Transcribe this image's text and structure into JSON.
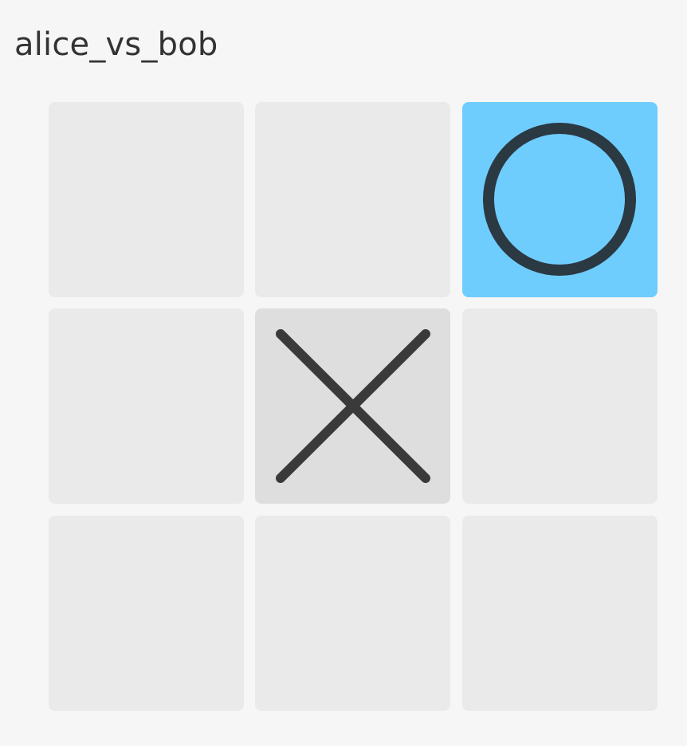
{
  "game": {
    "title": "alice_vs_bob"
  },
  "board": {
    "cells": [
      {
        "mark": "",
        "state": "empty"
      },
      {
        "mark": "",
        "state": "empty"
      },
      {
        "mark": "O",
        "state": "last-move"
      },
      {
        "mark": "",
        "state": "empty"
      },
      {
        "mark": "X",
        "state": "played"
      },
      {
        "mark": "",
        "state": "empty"
      },
      {
        "mark": "",
        "state": "empty"
      },
      {
        "mark": "",
        "state": "empty"
      },
      {
        "mark": "",
        "state": "empty"
      }
    ]
  },
  "colors": {
    "background": "#f6f6f6",
    "cell_empty": "#eaeaea",
    "cell_played": "#dedede",
    "cell_last_move": "#6fcdfe",
    "x_mark": "#3a3a3a",
    "o_mark": "#2b3942",
    "title_text": "#333333"
  },
  "icons": {
    "x": "x-mark-icon",
    "o": "o-mark-icon"
  }
}
